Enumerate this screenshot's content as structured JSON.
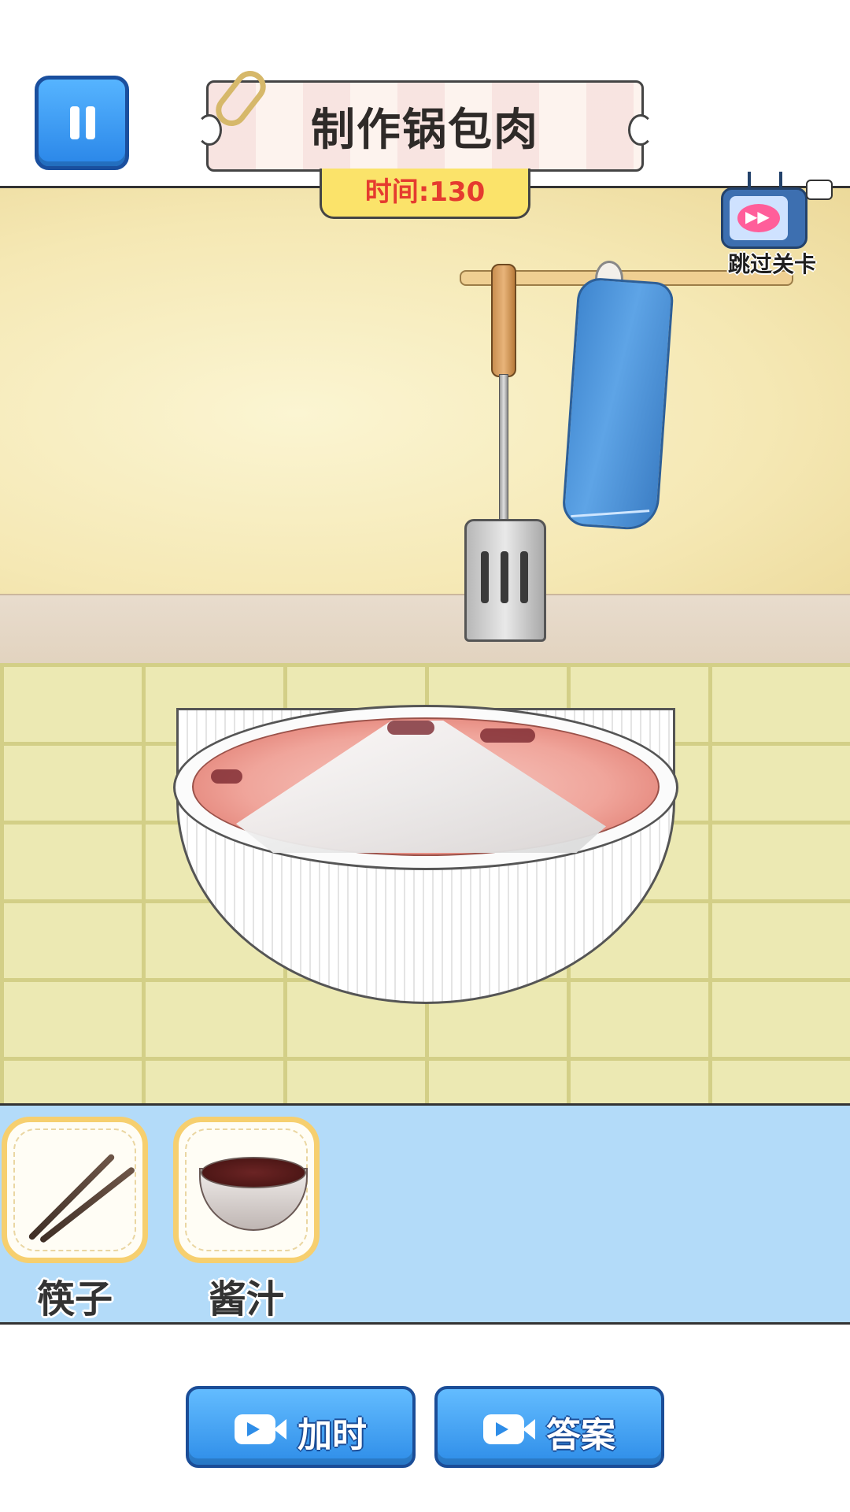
{
  "header": {
    "title": "制作锅包肉",
    "timer_label": "时间:",
    "timer_value": "130"
  },
  "skip": {
    "label": "跳过关卡",
    "icon": "tv-fast-forward-icon"
  },
  "items": [
    {
      "label": "筷子",
      "icon": "chopsticks-icon"
    },
    {
      "label": "酱汁",
      "icon": "sauce-bowl-icon"
    }
  ],
  "actions": {
    "add_time": "加时",
    "answer": "答案",
    "icon": "video-camera-icon"
  },
  "colors": {
    "accent_blue": "#2e8de8",
    "timer_red": "#e53b2f",
    "card_border": "#f6cf6f",
    "shelf_bg": "#b3dbf9"
  }
}
